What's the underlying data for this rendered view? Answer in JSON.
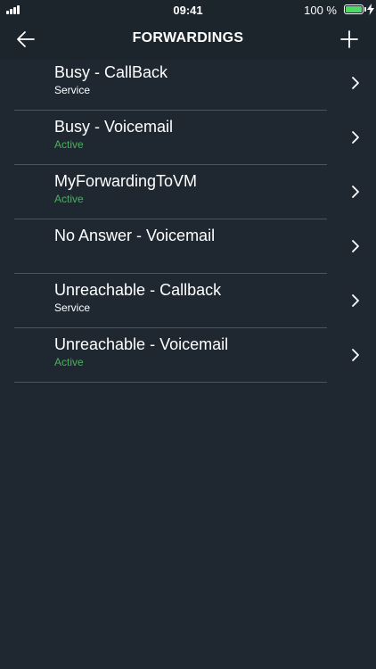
{
  "status_bar": {
    "time": "09:41",
    "battery_percent_label": "100 %",
    "battery_level": 1.0,
    "signal_bars": 4
  },
  "nav": {
    "title": "FORWARDINGS",
    "back_icon": "arrow-left-icon",
    "add_icon": "plus-icon"
  },
  "forwardings": [
    {
      "title": "Busy - CallBack",
      "subtitle": "Service",
      "status": "service"
    },
    {
      "title": "Busy - Voicemail",
      "subtitle": "Active",
      "status": "active"
    },
    {
      "title": "MyForwardingToVM",
      "subtitle": "Active",
      "status": "active"
    },
    {
      "title": "No Answer - Voicemail",
      "subtitle": "",
      "status": "none"
    },
    {
      "title": "Unreachable - Callback",
      "subtitle": "Service",
      "status": "service"
    },
    {
      "title": "Unreachable - Voicemail",
      "subtitle": "Active",
      "status": "active"
    }
  ],
  "colors": {
    "background": "#1f2831",
    "active": "#4caf62",
    "divider": "#4b545c",
    "battery": "#4cd964"
  }
}
